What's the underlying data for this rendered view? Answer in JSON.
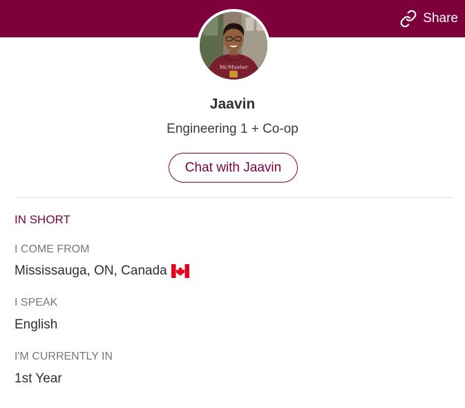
{
  "header": {
    "share_label": "Share",
    "accent_color": "#7d003c"
  },
  "profile": {
    "avatar_icon": "profile-photo",
    "name": "Jaavin",
    "program": "Engineering 1 + Co-op",
    "chat_label": "Chat with Jaavin"
  },
  "in_short": {
    "title": "IN SHORT",
    "come_from_label": "I COME FROM",
    "come_from_value": "Mississauga, ON, Canada",
    "country_flag_icon": "canada-flag-icon",
    "speak_label": "I SPEAK",
    "speak_value": "English",
    "currently_in_label": "I'M CURRENTLY IN",
    "currently_in_value": "1st Year"
  }
}
